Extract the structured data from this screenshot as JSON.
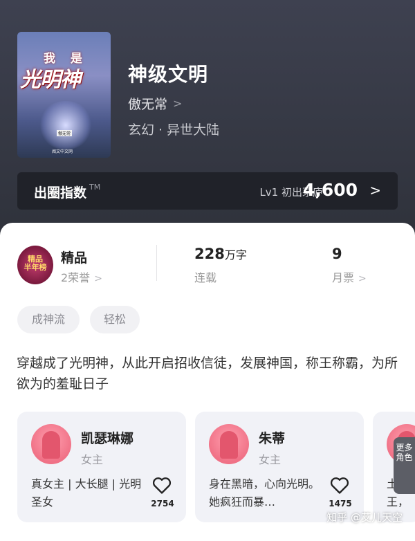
{
  "book": {
    "cover": {
      "line1": "我 是",
      "line2": "光明神",
      "author": "傲无常",
      "publisher": "阅文中文网"
    },
    "title": "神级文明",
    "author": "傲无常",
    "genre": "玄幻 · 异世大陆"
  },
  "score_bar": {
    "label": "出圈指数",
    "tm": "TM",
    "level_text": "Lv1 初出茅庐",
    "value": "4,600",
    "arrow": ">"
  },
  "stats": {
    "badge_text": "精品 半年榜",
    "quality": "精品",
    "honors": "2荣誉",
    "words_num": "228",
    "words_unit": "万字",
    "status": "连载",
    "votes_num": "9",
    "votes_label": "月票"
  },
  "tags": [
    "成神流",
    "轻松"
  ],
  "description": "穿越成了光明神，从此开启招收信徒，发展神国，称王称霸，为所欲为的羞耻日子",
  "characters": [
    {
      "name": "凯瑟琳娜",
      "role": "女主",
      "desc": "真女主 | 大长腿 | 光明圣女",
      "likes": "2754"
    },
    {
      "name": "朱蒂",
      "role": "女主",
      "desc": "身在黑暗，心向光明。她疯狂而暴…",
      "likes": "1475"
    },
    {
      "name": "",
      "role": "",
      "desc": "土王，",
      "likes": ""
    }
  ],
  "more_roles": "更多角色",
  "watermark": "知乎 @艾儿天空",
  "colors": {
    "header_bg": "#3e4150",
    "score_bar_bg": "#202229",
    "card_bg": "#f1f2f7",
    "avatar": "#f07186"
  }
}
